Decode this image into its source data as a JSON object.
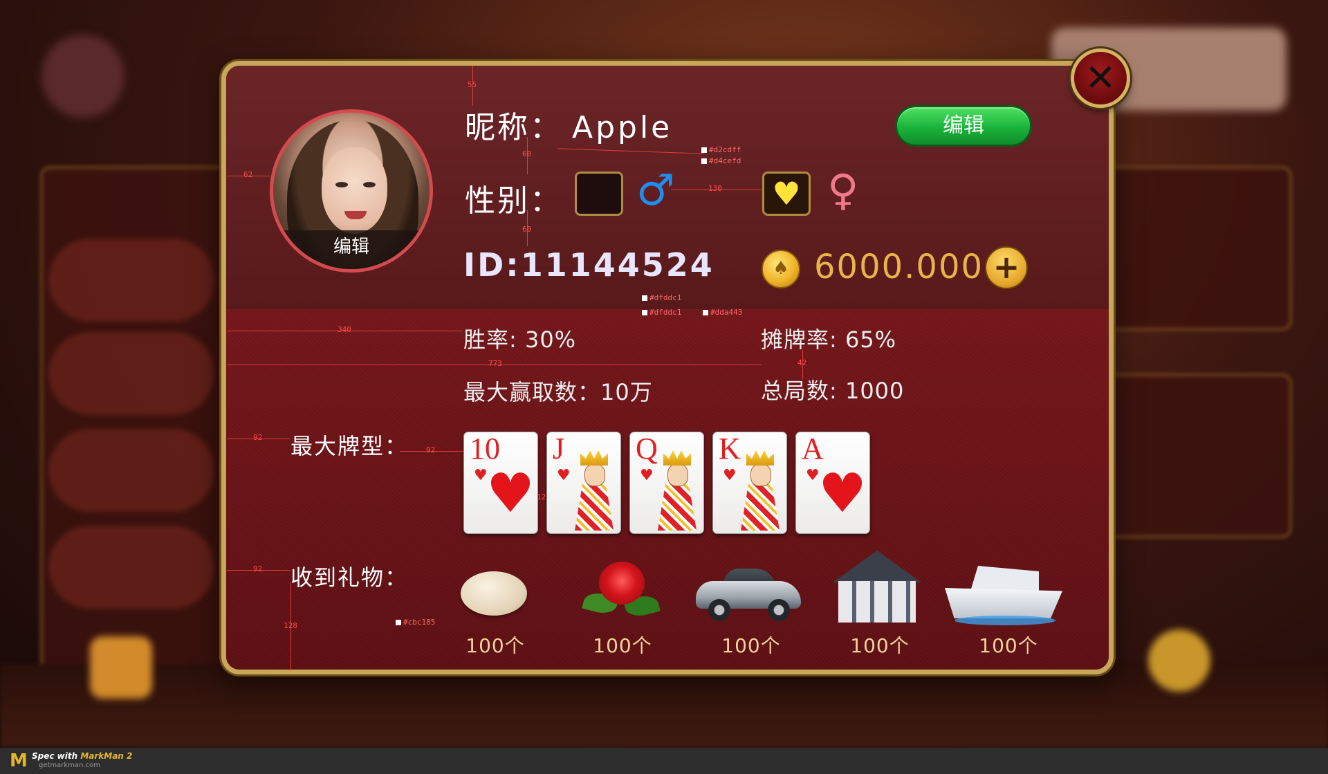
{
  "profile": {
    "nickname_label": "昵称：",
    "nickname": "Apple",
    "gender_label": "性别：",
    "male_symbol": "♂",
    "female_symbol": "♀",
    "female_selected_icon": "♥",
    "id_text": "ID:11144524",
    "avatar_edit_label": "编辑",
    "edit_button_label": "编辑",
    "gold_amount": "6000.000",
    "plus_label": "+",
    "close_label": "✕"
  },
  "stats": {
    "win_rate": "胜率: 30%",
    "showdown_rate": "摊牌率: 65%",
    "max_win": "最大赢取数：10万",
    "total_games": "总局数: 1000"
  },
  "best_hand": {
    "label": "最大牌型：",
    "cards": [
      {
        "rank": "10",
        "suit": "♥",
        "type": "number"
      },
      {
        "rank": "J",
        "suit": "♥",
        "type": "face"
      },
      {
        "rank": "Q",
        "suit": "♥",
        "type": "face"
      },
      {
        "rank": "K",
        "suit": "♥",
        "type": "face"
      },
      {
        "rank": "A",
        "suit": "♥",
        "type": "number"
      }
    ]
  },
  "gifts": {
    "label": "收到礼物：",
    "items": [
      {
        "icon": "egg-icon",
        "count": "100个"
      },
      {
        "icon": "rose-icon",
        "count": "100个"
      },
      {
        "icon": "sports-car-icon",
        "count": "100个"
      },
      {
        "icon": "house-icon",
        "count": "100个"
      },
      {
        "icon": "yacht-icon",
        "count": "100个"
      }
    ]
  },
  "annotations": {
    "d55": "55",
    "d60a": "60",
    "d60b": "60",
    "d62": "62",
    "d130": "130",
    "d340": "340",
    "d773": "773",
    "d42": "42",
    "d92a": "92",
    "d92b": "92",
    "d92c": "92",
    "d12": "12",
    "d128": "128",
    "c1": "#d2cdff",
    "c2": "#d4cefd",
    "c3": "#dfddc1",
    "c4": "#dfddc1",
    "c5": "#dda443",
    "c6": "#cbc185"
  },
  "footer": {
    "logo": "M",
    "line1_prefix": "Spec with ",
    "line1_brand": "MarkMan 2",
    "line2": "getmarkman.com"
  },
  "colors": {
    "accent_gold": "#c9a75a",
    "gold_text": "#e9b448",
    "edit_green": "#1ab33b",
    "heart_red": "#e01f23",
    "male_blue": "#1e8ff0",
    "female_pink": "#f07a8a"
  }
}
